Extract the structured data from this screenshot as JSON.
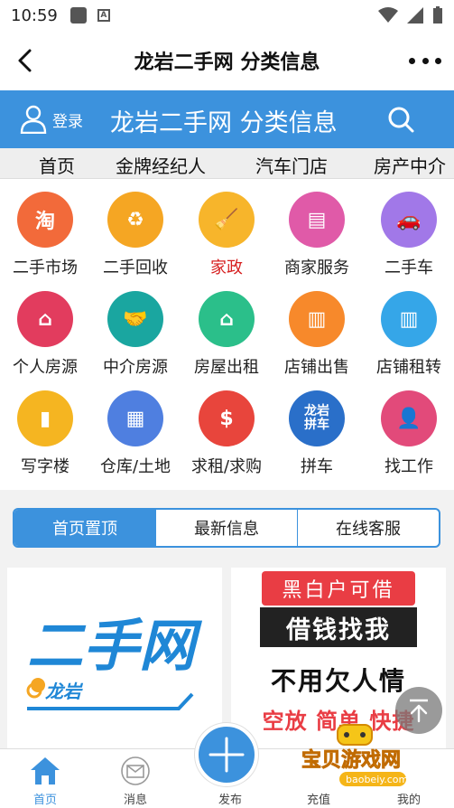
{
  "statusbar": {
    "time": "10:59",
    "icon_a": "A"
  },
  "titlebar": {
    "title": "龙岩二手网 分类信息"
  },
  "bluebar": {
    "login_label": "登录",
    "site_title": "龙岩二手网 分类信息"
  },
  "tabs": [
    "首页",
    "金牌经纪人",
    "汽车门店",
    "房产中介"
  ],
  "grid": [
    {
      "label": "二手市场",
      "icon": "taobao-icon",
      "glyph": "淘",
      "color": "#f26a3a"
    },
    {
      "label": "二手回收",
      "icon": "recycle-icon",
      "glyph": "♻",
      "color": "#f5a623"
    },
    {
      "label": "家政",
      "icon": "broom-icon",
      "glyph": "🧹",
      "color": "#f7b52b",
      "highlight": true
    },
    {
      "label": "商家服务",
      "icon": "document-icon",
      "glyph": "▤",
      "color": "#e05aa8"
    },
    {
      "label": "二手车",
      "icon": "car-icon",
      "glyph": "🚗",
      "color": "#a178e8"
    },
    {
      "label": "个人房源",
      "icon": "family-house-icon",
      "glyph": "⌂",
      "color": "#e23c5e"
    },
    {
      "label": "中介房源",
      "icon": "handshake-icon",
      "glyph": "🤝",
      "color": "#1aa6a0"
    },
    {
      "label": "房屋出租",
      "icon": "house-icon",
      "glyph": "⌂",
      "color": "#2bbf8a"
    },
    {
      "label": "店铺出售",
      "icon": "shop-icon",
      "glyph": "▥",
      "color": "#f7892b"
    },
    {
      "label": "店铺租转",
      "icon": "storefront-icon",
      "glyph": "▥",
      "color": "#35a6e8"
    },
    {
      "label": "写字楼",
      "icon": "building-icon",
      "glyph": "▮",
      "color": "#f5b521"
    },
    {
      "label": "仓库/土地",
      "icon": "warehouse-icon",
      "glyph": "▦",
      "color": "#4f7fe0"
    },
    {
      "label": "求租/求购",
      "icon": "money-house-icon",
      "glyph": "$",
      "color": "#e8453c"
    },
    {
      "label": "拼车",
      "icon": "carpool-badge-icon",
      "glyph": "龙岩\n拼车",
      "color": "#2a6fc9"
    },
    {
      "label": "找工作",
      "icon": "worker-icon",
      "glyph": "👤",
      "color": "#e24a7a"
    }
  ],
  "segments": [
    "首页置顶",
    "最新信息",
    "在线客服"
  ],
  "banner_left": {
    "brand": "二手网",
    "city": "龙岩"
  },
  "banner_right": {
    "line1": "黑白户可借",
    "line2": "借钱找我",
    "line3": "不用欠人情",
    "line4": "空放 简单 快捷"
  },
  "bottomnav": {
    "home": "首页",
    "messages": "消息",
    "publish": "发布",
    "recharge": "充值",
    "mine": "我的"
  },
  "watermark": {
    "text": "宝贝游戏网",
    "url": "baobeiy.com"
  }
}
